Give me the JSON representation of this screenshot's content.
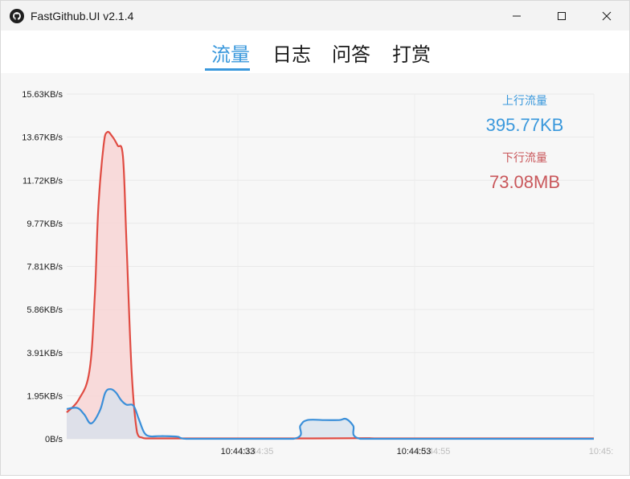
{
  "window": {
    "title": "FastGithub.UI v2.1.4"
  },
  "tabs": [
    {
      "label": "流量",
      "active": true
    },
    {
      "label": "日志",
      "active": false
    },
    {
      "label": "问答",
      "active": false
    },
    {
      "label": "打赏",
      "active": false
    }
  ],
  "stats": {
    "upload_label": "上行流量",
    "upload_value": "395.77KB",
    "upload_color": "#3a98dc",
    "download_label": "下行流量",
    "download_value": "73.08MB",
    "download_color": "#c9575b"
  },
  "chart_data": {
    "type": "area",
    "y_tick_labels": [
      "15.63KB/s",
      "13.67KB/s",
      "11.72KB/s",
      "9.77KB/s",
      "7.81KB/s",
      "5.86KB/s",
      "3.91KB/s",
      "1.95KB/s",
      "0B/s"
    ],
    "ylim": [
      0,
      15.63
    ],
    "grid": true,
    "x_tick_labels_primary": [
      "10:44:33",
      "10:44:53"
    ],
    "x_tick_labels_faint": [
      "10:44:35",
      "10:44:55",
      "10:45:"
    ],
    "series": [
      {
        "color": "#e04b42",
        "fill": "#f7d6d6",
        "x": [
          0,
          0.7,
          1.3,
          1.6,
          1.8,
          2.1,
          2.3,
          2.6,
          2.9,
          3.2,
          3.4,
          3.7,
          4.0,
          4.3,
          4.6,
          4.9,
          8.8,
          9.6,
          14.0,
          17.0,
          17.6,
          20.5,
          22.5,
          28.5,
          30.0
        ],
        "values": [
          1.2,
          1.8,
          3.1,
          6.5,
          10.5,
          13.3,
          13.9,
          13.7,
          13.3,
          12.8,
          9.0,
          3.0,
          0.3,
          0.05,
          0.02,
          0.02,
          0.02,
          0.02,
          0.02,
          0.03,
          0.02,
          0.02,
          0.02,
          0.02,
          0.02
        ]
      },
      {
        "color": "#3a8fd9",
        "fill": "#d5e1ee",
        "x": [
          0,
          0.6,
          1.0,
          1.4,
          1.9,
          2.2,
          2.5,
          2.8,
          3.1,
          3.4,
          3.8,
          4.1,
          4.4,
          4.7,
          5.2,
          5.6,
          6.3,
          6.8,
          9.0,
          12.9,
          13.3,
          13.7,
          14.7,
          15.5,
          15.9,
          16.3,
          16.7,
          20.0,
          30.0
        ],
        "values": [
          1.35,
          1.4,
          1.1,
          0.7,
          1.3,
          2.1,
          2.25,
          2.1,
          1.75,
          1.55,
          1.5,
          0.9,
          0.3,
          0.12,
          0.12,
          0.12,
          0.1,
          0.0,
          0.0,
          0.0,
          0.6,
          0.85,
          0.85,
          0.85,
          0.9,
          0.6,
          0.0,
          0.0,
          0.0
        ]
      }
    ]
  }
}
